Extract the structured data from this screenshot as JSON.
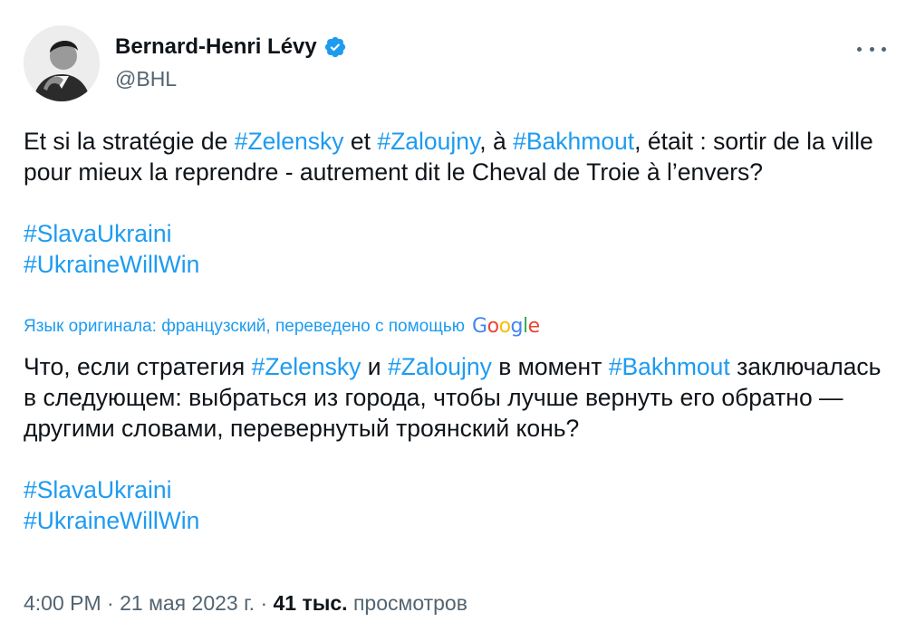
{
  "author": {
    "name": "Bernard-Henri Lévy",
    "handle": "@BHL"
  },
  "original": {
    "seg1": "Et si la stratégie de ",
    "tag1": "#Zelensky",
    "seg2": " et ",
    "tag2": "#Zaloujny",
    "seg3": ", à ",
    "tag3": "#Bakhmout",
    "seg4": ", était : sortir de la ville pour mieux la reprendre - autrement dit le Cheval de Troie à l’envers?",
    "hashtags": [
      "#SlavaUkraini",
      "#UkraineWillWin"
    ]
  },
  "translation_note": {
    "label": "Язык оригинала: французский, переведено с помощью",
    "provider": "Google"
  },
  "translated": {
    "seg1": "Что, если стратегия ",
    "tag1": "#Zelensky",
    "seg2": " и ",
    "tag2": "#Zaloujny",
    "seg3": " в момент ",
    "tag3": "#Bakhmout",
    "seg4": " заключалась в следующем: выбраться из города, чтобы лучше вернуть его обратно — другими словами, перевернутый троянский конь?",
    "hashtags": [
      "#SlavaUkraini",
      "#UkraineWillWin"
    ]
  },
  "meta": {
    "time": "4:00 PM",
    "sep1": " · ",
    "date": "21 мая 2023 г.",
    "sep2": " · ",
    "views_count": "41 тыс.",
    "views_label": " просмотров"
  },
  "colors": {
    "link": "#1d9bf0",
    "text": "#0f1419",
    "muted": "#536471"
  },
  "icons": {
    "verified": "verified-badge-icon",
    "more": "more-options-icon"
  }
}
